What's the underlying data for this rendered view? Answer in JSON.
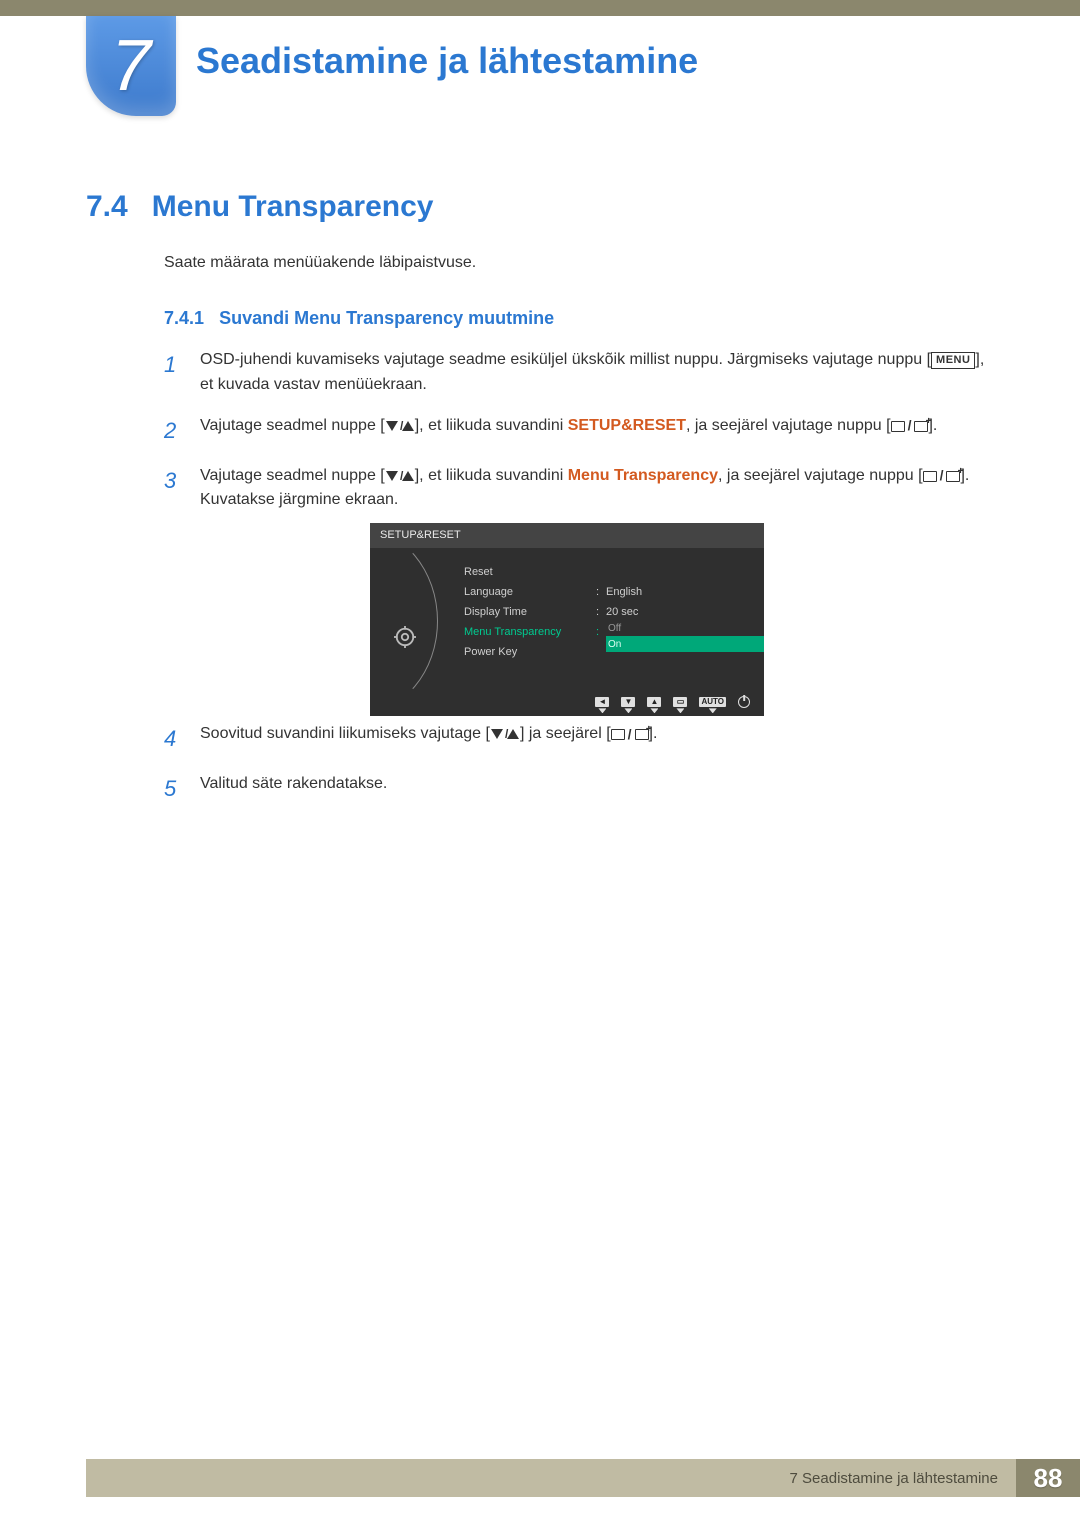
{
  "chapter": {
    "number": "7",
    "title": "Seadistamine ja lähtestamine"
  },
  "section": {
    "number": "7.4",
    "title": "Menu Transparency",
    "intro": "Saate määrata menüüakende läbipaistvuse."
  },
  "subsection": {
    "number": "7.4.1",
    "title": "Suvandi Menu Transparency muutmine"
  },
  "steps": {
    "s1_a": "OSD-juhendi kuvamiseks vajutage seadme esiküljel ükskõik millist nuppu. Järgmiseks vajutage nuppu [",
    "s1_b": "], et kuvada vastav menüüekraan.",
    "s2_a": "Vajutage seadmel nuppe [",
    "s2_b": "], et liikuda suvandini ",
    "s2_hl": "SETUP&RESET",
    "s2_c": ", ja seejärel vajutage nuppu [",
    "s2_d": "].",
    "s3_a": "Vajutage seadmel nuppe [",
    "s3_b": "], et liikuda suvandini ",
    "s3_hl": "Menu Transparency",
    "s3_c": ", ja seejärel vajutage nuppu [",
    "s3_d": "]. Kuvatakse järgmine ekraan.",
    "s4_a": "Soovitud suvandini liikumiseks vajutage [",
    "s4_b": "] ja seejärel [",
    "s4_c": "].",
    "s5": "Valitud säte rakendatakse."
  },
  "menu_key": "MENU",
  "osd": {
    "header": "SETUP&RESET",
    "items": [
      {
        "label": "Reset",
        "value": ""
      },
      {
        "label": "Language",
        "value": "English"
      },
      {
        "label": "Display Time",
        "value": "20 sec"
      },
      {
        "label": "Menu Transparency",
        "value": "",
        "active": true
      },
      {
        "label": "Power Key",
        "value": ""
      }
    ],
    "options": [
      {
        "label": "Off",
        "selected": false
      },
      {
        "label": "On",
        "selected": true
      }
    ],
    "auto_label": "AUTO"
  },
  "footer": {
    "text": "7 Seadistamine ja lähtestamine",
    "page": "88"
  }
}
